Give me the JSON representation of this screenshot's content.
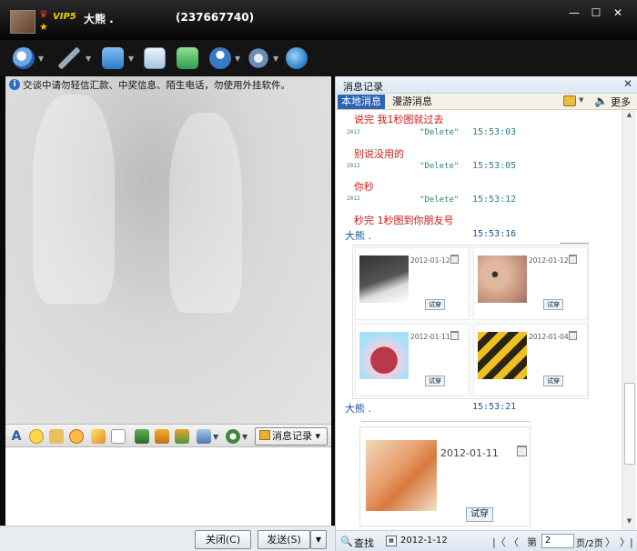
{
  "title_bar": {
    "vip_label": "VIP5",
    "nickname": "大熊 .",
    "qq_number": "(237667740)",
    "minimize": "—",
    "maximize": "☐",
    "close": "✕"
  },
  "toolbar": {
    "icons": [
      "video-call",
      "voice-call",
      "send-file",
      "send-email",
      "app-share",
      "remote-assist",
      "settings",
      "browser"
    ]
  },
  "chat": {
    "tip_text": "交谈中请勿轻信汇款、中奖信息、陌生电话，勿使用外挂软件。"
  },
  "format_bar": {
    "font_label": "A",
    "history_button": "消息记录"
  },
  "bottom_bar": {
    "close_label": "关闭(C)",
    "send_label": "发送(S)"
  },
  "history_panel": {
    "title": "消息记录",
    "tab_local": "本地消息",
    "tab_roam": "漫游消息",
    "more_label": "更多",
    "messages": [
      {
        "text": "说完 我1秒图就过去"
      },
      {
        "year": "2012",
        "delete": "\"Delete\"",
        "time": "15:53:03"
      },
      {
        "text": "别说没用的"
      },
      {
        "year": "2012",
        "delete": "\"Delete\"",
        "time": "15:53:05"
      },
      {
        "text": "你秒"
      },
      {
        "year": "2012",
        "delete": "\"Delete\"",
        "time": "15:53:12"
      },
      {
        "text": "秒完 1秒图到你朋友号"
      }
    ],
    "sender_1": {
      "name": "大熊 .",
      "time": "15:53:16"
    },
    "image_cards": [
      {
        "date": "2012-01-12",
        "button": "试穿"
      },
      {
        "date": "2012-01-12",
        "button": "试穿"
      },
      {
        "date": "2012-01-11",
        "button": "试穿"
      },
      {
        "date": "2012-01-04",
        "button": "试穿"
      }
    ],
    "sender_2": {
      "name": "大熊 .",
      "time": "15:53:21"
    },
    "big_card": {
      "date": "2012-01-11",
      "button": "试穿"
    },
    "footer": {
      "find_label": "查找",
      "date_value": "2012-1-12",
      "first": "|〈",
      "prev": "〈",
      "page_prefix": "第",
      "page_number": "2",
      "page_total": "页/2页",
      "next": "〉",
      "last": "〉|"
    }
  }
}
